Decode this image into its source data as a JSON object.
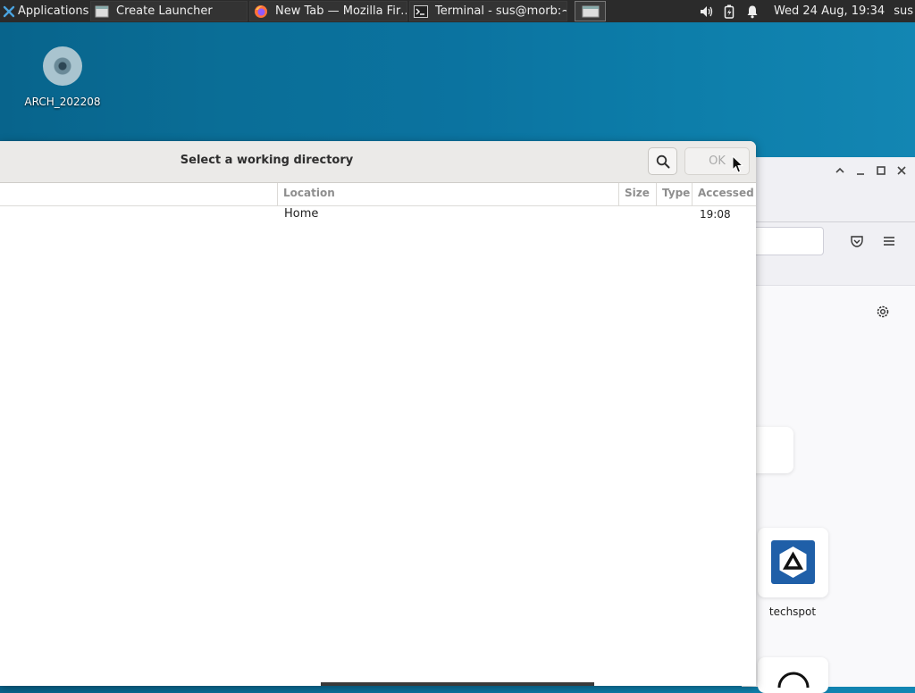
{
  "panel": {
    "applications_label": "Applications",
    "tasks": [
      {
        "label": "Create Launcher",
        "icon": "window-icon"
      },
      {
        "label": "New Tab — Mozilla Fir…",
        "icon": "firefox-icon"
      },
      {
        "label": "Terminal - sus@morb:~",
        "icon": "terminal-icon"
      }
    ],
    "clock": "Wed 24 Aug, 19:34",
    "user": "sus"
  },
  "desktop": {
    "icon_label": "ARCH_202208"
  },
  "dialog": {
    "title": "Select a working directory",
    "ok_label": "OK",
    "columns": [
      "Location",
      "Size",
      "Type",
      "Accessed"
    ],
    "rows": [
      {
        "name": "",
        "location": "Home",
        "size": "",
        "type": "",
        "accessed": "19:08"
      }
    ]
  },
  "firefox": {
    "tile_label": "techspot"
  },
  "colors": {
    "panel_bg": "#2b2b2b",
    "desktop": "#0b73a0",
    "dialog_header": "#ebeae8",
    "tile_accent": "#1f5fa8"
  }
}
